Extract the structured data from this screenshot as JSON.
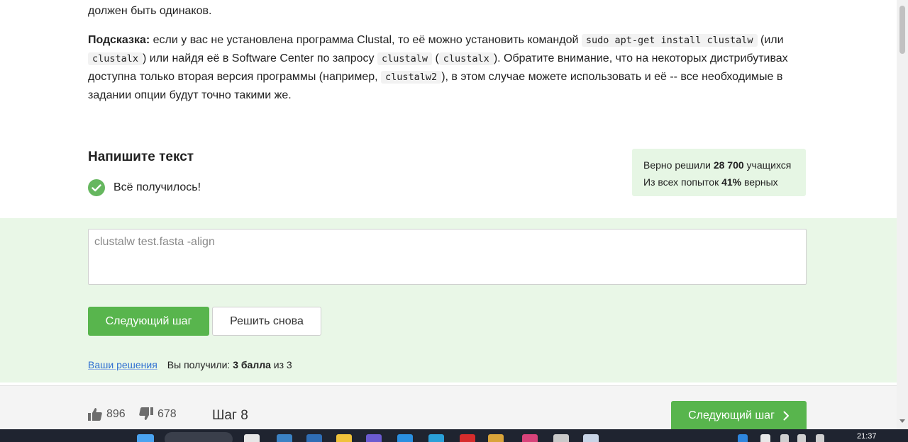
{
  "task_text": {
    "line0": "должен быть одинаков.",
    "hint_label": "Подсказка:",
    "hint_seg1": " если у вас не установлена программа Clustal, то её можно установить командой ",
    "code1": "sudo apt-get install clustalw",
    "hint_seg2": " (или ",
    "code2": "clustalx",
    "hint_seg3": ") или найдя её в Software Center по запросу ",
    "code3": "clustalw",
    "hint_seg4": " (",
    "code4": "clustalx",
    "hint_seg5": "). Обратите внимание, что на некоторых дистрибутивах доступна только вторая версия программы (например, ",
    "code5": "clustalw2",
    "hint_seg6": "), в этом случае можете использовать и её -- все необходимые в задании опции будут точно такими же."
  },
  "task": {
    "title": "Напишите текст",
    "status": "Всё получилось!"
  },
  "stats": {
    "solved_prefix": "Верно решили ",
    "solved_count": "28 700",
    "solved_suffix": " учащихся",
    "attempts_prefix": "Из всех попыток ",
    "attempts_pct": "41%",
    "attempts_suffix": " верных"
  },
  "answer": {
    "value": "clustalw test.fasta -align"
  },
  "buttons": {
    "next_step": "Следующий шаг",
    "retry": "Решить снова"
  },
  "solutions": {
    "link": "Ваши решения",
    "score_prefix": "Вы получили: ",
    "score_value": "3 балла",
    "score_suffix": " из 3"
  },
  "footer": {
    "likes": "896",
    "dislikes": "678",
    "step_label": "Шаг 8",
    "next_step": "Следующий шаг"
  },
  "taskbar": {
    "clock": "21:37"
  },
  "colors": {
    "accent_green": "#58b54d",
    "success_bg": "#e9f7e7",
    "link_blue": "#2e6fd1"
  }
}
